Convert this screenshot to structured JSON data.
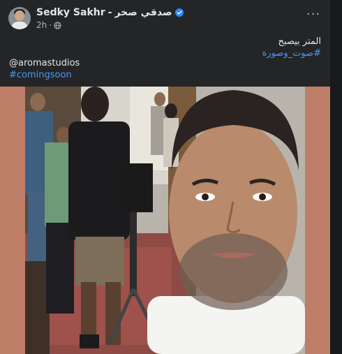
{
  "post": {
    "author_name": "Sedky Sakhr",
    "author_separator": "-",
    "author_name_arabic": "صدقي صخر",
    "time": "2h",
    "meta_dot": "·",
    "more_options": "···",
    "text_arabic": "المتر بيصبح",
    "hashtag_arabic": "#صوت_وصورة",
    "mention": "@aromastudios",
    "hashtag_coming": "#comingsoon"
  },
  "icons": {
    "verified": "verified-badge-icon",
    "audience": "globe-icon",
    "more": "more-horizontal-icon"
  },
  "colors": {
    "card_bg": "#242526",
    "page_bg": "#18191a",
    "text_primary": "#e4e6eb",
    "text_secondary": "#b0b3b8",
    "link": "#4599ff",
    "verified": "#2d88ff",
    "media_bg": "#bf7e68"
  }
}
